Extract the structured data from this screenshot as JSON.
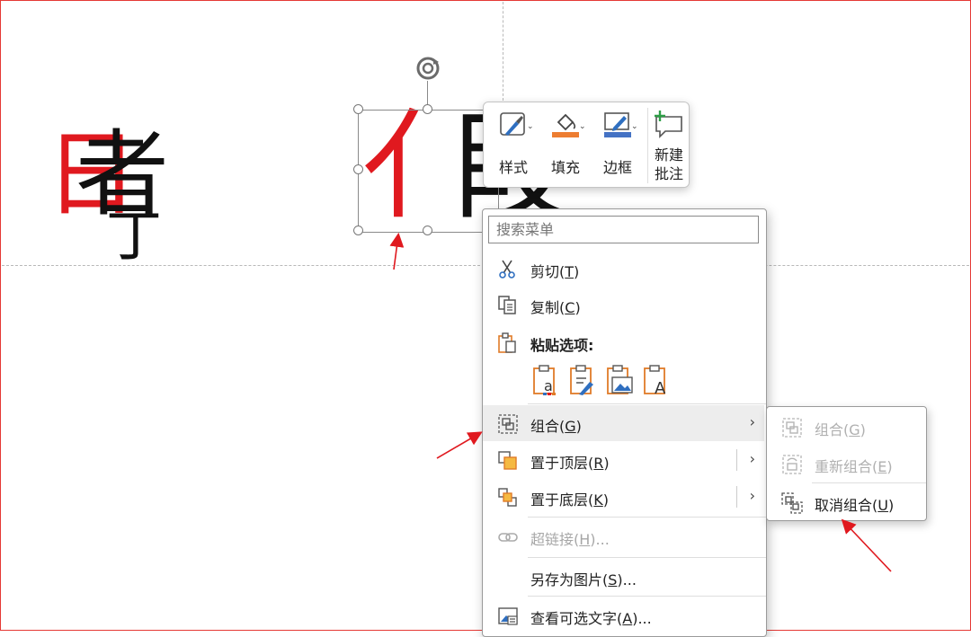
{
  "slide": {
    "char_shu_red": "日",
    "char_shu_black": "者",
    "char_frag": "丁",
    "char_jia_red": "亻",
    "char_jia_black": "叚"
  },
  "minibar": {
    "style_label": "样式",
    "fill_label": "填充",
    "border_label": "边框",
    "comment_label_line1": "新建",
    "comment_label_line2": "批注",
    "fill_color": "#ed7d31",
    "border_color": "#4472c4"
  },
  "context_menu": {
    "search_placeholder": "搜索菜单",
    "items": [
      {
        "label": "剪切",
        "key": "T",
        "icon": "scissors-icon"
      },
      {
        "label": "复制",
        "key": "C",
        "icon": "copy-icon"
      },
      {
        "label": "粘贴选项:",
        "icon": "clipboard-icon"
      },
      {
        "label": "组合",
        "key": "G",
        "icon": "group-icon"
      },
      {
        "label": "置于顶层",
        "key": "R",
        "icon": "bring-to-front-icon"
      },
      {
        "label": "置于底层",
        "key": "K",
        "icon": "send-to-back-icon"
      },
      {
        "label": "超链接",
        "key": "H",
        "suffix": "...",
        "icon": "link-icon"
      },
      {
        "label": "另存为图片",
        "key": "S",
        "suffix": "..."
      },
      {
        "label": "查看可选文字",
        "key": "A",
        "suffix": "...",
        "icon": "alt-text-icon"
      }
    ]
  },
  "group_submenu": {
    "items": [
      {
        "label": "组合",
        "key": "G"
      },
      {
        "label": "重新组合",
        "key": "E"
      },
      {
        "label": "取消组合",
        "key": "U"
      }
    ]
  },
  "colors": {
    "annotation_red": "#e0191f",
    "slide_border": "#e53935",
    "icon_orange": "#e07b28",
    "icon_blue": "#2f6fc0"
  }
}
